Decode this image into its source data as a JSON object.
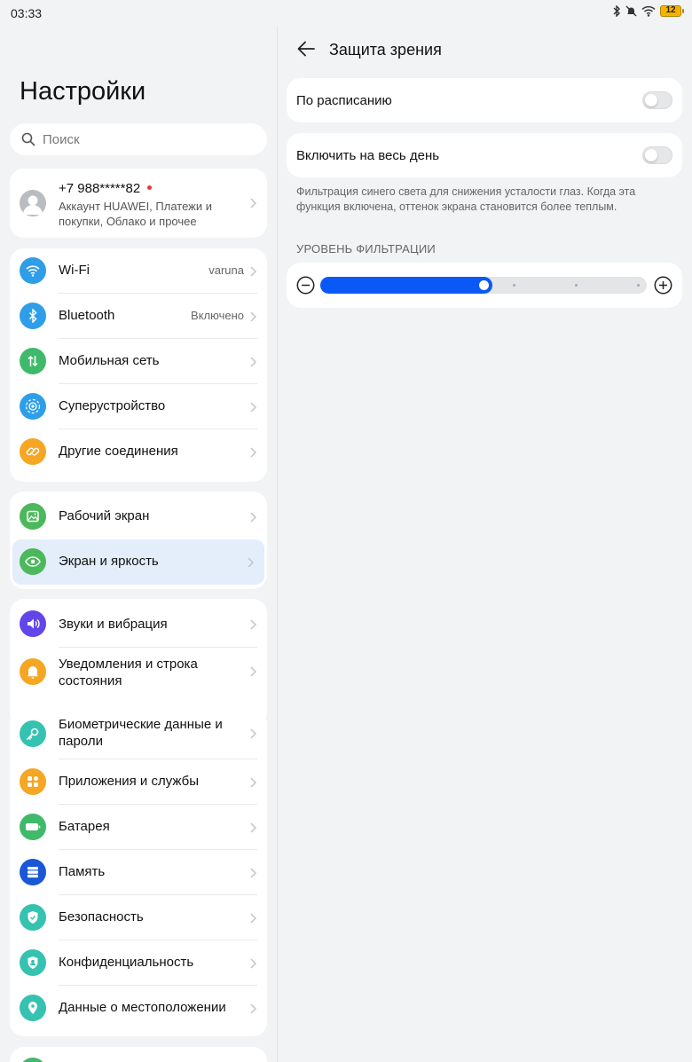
{
  "status": {
    "time": "03:33",
    "battery": "12"
  },
  "left": {
    "title": "Настройки",
    "search_placeholder": "Поиск",
    "account": {
      "phone": "+7 988*****82",
      "subtitle": "Аккаунт HUAWEI, Платежи и покупки, Облако и прочее"
    },
    "connectivity": [
      {
        "label": "Wi-Fi",
        "value": "varuna",
        "icon": "wifi-icon",
        "color": "#2f9ee8"
      },
      {
        "label": "Bluetooth",
        "value": "Включено",
        "icon": "bluetooth-icon",
        "color": "#2f9ee8"
      },
      {
        "label": "Мобильная сеть",
        "value": "",
        "icon": "mobile-network-icon",
        "color": "#3fba6a"
      },
      {
        "label": "Суперустройство",
        "value": "",
        "icon": "superdevice-icon",
        "color": "#2f9ee8"
      },
      {
        "label": "Другие соединения",
        "value": "",
        "icon": "link-icon",
        "color": "#f5a623"
      }
    ],
    "display": [
      {
        "label": "Рабочий экран",
        "icon": "home-screen-icon",
        "color": "#4cb85c"
      },
      {
        "label": "Экран и яркость",
        "icon": "eye-icon",
        "color": "#4cb85c",
        "selected": true
      }
    ],
    "notifications": [
      {
        "label": "Звуки и вибрация",
        "icon": "sound-icon",
        "color": "#6246ea"
      },
      {
        "label": "Уведомления и строка состояния",
        "icon": "bell-icon",
        "color": "#f5a623"
      }
    ],
    "system": [
      {
        "label": "Биометрические данные и пароли",
        "icon": "key-icon",
        "color": "#36c2b0"
      },
      {
        "label": "Приложения и службы",
        "icon": "apps-icon",
        "color": "#f5a623"
      },
      {
        "label": "Батарея",
        "icon": "battery-icon",
        "color": "#3fba6a"
      },
      {
        "label": "Память",
        "icon": "storage-icon",
        "color": "#1a57d6"
      },
      {
        "label": "Безопасность",
        "icon": "shield-icon",
        "color": "#36c2b0"
      },
      {
        "label": "Конфиденциальность",
        "icon": "privacy-icon",
        "color": "#36c2b0"
      },
      {
        "label": "Данные о местоположении",
        "icon": "location-icon",
        "color": "#36c2b0"
      }
    ]
  },
  "right": {
    "title": "Защита зрения",
    "schedule_label": "По расписанию",
    "schedule_on": false,
    "all_day_label": "Включить на весь день",
    "all_day_on": false,
    "description": "Фильтрация синего света для снижения усталости глаз. Когда эта функция включена, оттенок экрана становится более теплым.",
    "filter_header": "УРОВЕНЬ ФИЛЬТРАЦИИ",
    "filter_level": 0.5,
    "filter_steps": 5,
    "accent": "#0a59f7"
  }
}
